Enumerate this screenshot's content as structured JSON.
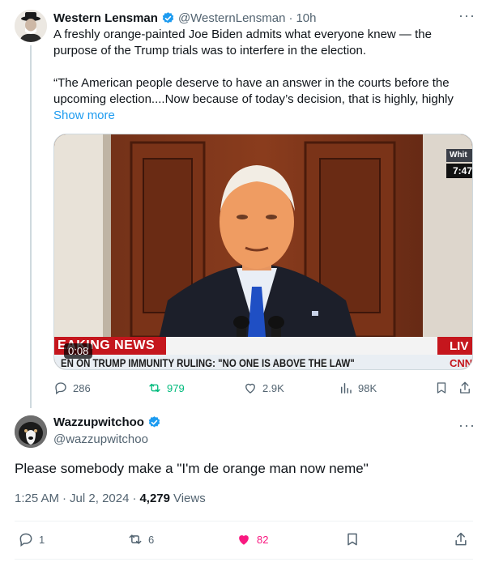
{
  "tweet1": {
    "display_name": "Western Lensman",
    "handle": "@WesternLensman",
    "separator": "·",
    "time": "10h",
    "text_line1": "A freshly orange-painted Joe Biden admits what everyone knew — the",
    "text_line2": "purpose of the Trump trials was to interfere in the election.",
    "quote_line1": "“The American people deserve to have an answer in the courts before the",
    "quote_line2": "upcoming election....Now because of today’s decision, that is highly, highly",
    "show_more": "Show more",
    "video": {
      "duration": "0:08",
      "chyron_banner": "EAKING NEWS",
      "chyron_ticker": "EN ON TRUMP IMMUNITY RULING: \"NO ONE IS ABOVE THE LAW\"",
      "corner_top": "Whit",
      "corner_time": "7:47",
      "live_label": "LIV",
      "network_logo": "CNN"
    },
    "actions": {
      "replies": "286",
      "reposts": "979",
      "likes": "2.9K",
      "views": "98K"
    },
    "colors": {
      "repost_green": "#00ba7c"
    }
  },
  "tweet2": {
    "display_name": "Wazzupwitchoo",
    "handle": "@wazzupwitchoo",
    "text": "Please somebody make a \"I'm de orange man now neme\"",
    "time": "1:25 AM",
    "date": "Jul 2, 2024",
    "separator": "·",
    "views_count": "4,279",
    "views_label": "Views",
    "actions": {
      "replies": "1",
      "reposts": "6",
      "likes": "82"
    },
    "colors": {
      "like_pink": "#f91880"
    }
  },
  "icons": {
    "verified": "verified-badge-icon",
    "more": "more-dots-icon",
    "reply": "reply-icon",
    "repost": "repost-icon",
    "like": "heart-icon",
    "views": "views-icon",
    "bookmark": "bookmark-icon",
    "share": "share-icon"
  }
}
